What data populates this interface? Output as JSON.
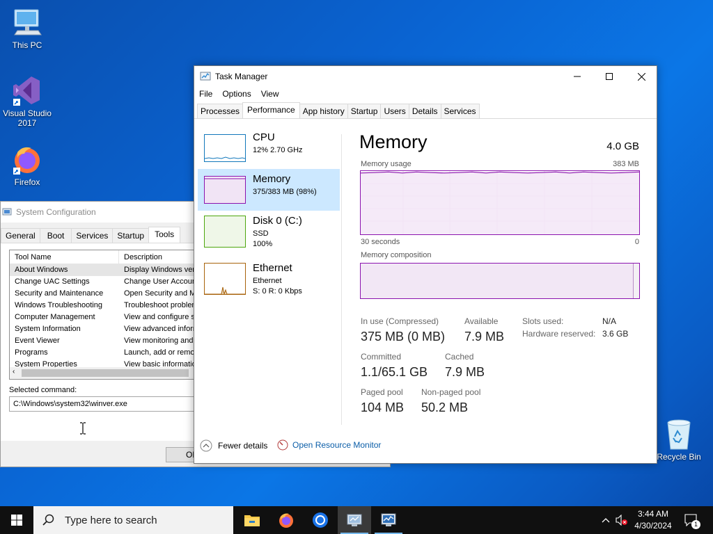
{
  "desktop": {
    "icons": [
      {
        "label": "This PC"
      },
      {
        "label": "Visual Studio 2017"
      },
      {
        "label": "Firefox"
      },
      {
        "label": "Recycle Bin"
      }
    ]
  },
  "msconfig": {
    "title": "System Configuration",
    "tabs": [
      "General",
      "Boot",
      "Services",
      "Startup",
      "Tools"
    ],
    "active_tab": "Tools",
    "columns": [
      "Tool Name",
      "Description"
    ],
    "rows": [
      {
        "name": "About Windows",
        "desc": "Display Windows version information."
      },
      {
        "name": "Change UAC Settings",
        "desc": "Change User Account Control settings."
      },
      {
        "name": "Security and Maintenance",
        "desc": "Open Security and Maintenance."
      },
      {
        "name": "Windows Troubleshooting",
        "desc": "Troubleshoot problems with your computer."
      },
      {
        "name": "Computer Management",
        "desc": "View and configure system settings and components."
      },
      {
        "name": "System Information",
        "desc": "View advanced information about hardware and software settings."
      },
      {
        "name": "Event Viewer",
        "desc": "View monitoring and troubleshooting messages."
      },
      {
        "name": "Programs",
        "desc": "Launch, add or remove programs and Windows components."
      },
      {
        "name": "System Properties",
        "desc": "View basic information about your computer system settings."
      }
    ],
    "selected_command_label": "Selected command:",
    "selected_command": "C:\\Windows\\system32\\winver.exe",
    "ok_label": "OK"
  },
  "taskmgr": {
    "title": "Task Manager",
    "menu": [
      "File",
      "Options",
      "View"
    ],
    "tabs": [
      "Processes",
      "Performance",
      "App history",
      "Startup",
      "Users",
      "Details",
      "Services"
    ],
    "active_tab": "Performance",
    "sidebar": [
      {
        "name": "CPU",
        "line1": "12%  2.70 GHz",
        "line2": "",
        "color": "#1177bb"
      },
      {
        "name": "Memory",
        "line1": "375/383 MB (98%)",
        "line2": "",
        "color": "#8b12ae"
      },
      {
        "name": "Disk 0 (C:)",
        "line1": "SSD",
        "line2": "100%",
        "color": "#4da60c"
      },
      {
        "name": "Ethernet",
        "line1": "Ethernet",
        "line2": "S: 0  R: 0 Kbps",
        "color": "#a7620a"
      }
    ],
    "memory": {
      "title": "Memory",
      "total": "4.0 GB",
      "usage_label": "Memory usage",
      "usage_max": "383 MB",
      "time_left": "30 seconds",
      "time_right": "0",
      "composition_label": "Memory composition",
      "stats": {
        "in_use_label": "In use (Compressed)",
        "in_use": "375 MB (0 MB)",
        "available_label": "Available",
        "available": "7.9 MB",
        "committed_label": "Committed",
        "committed": "1.1/65.1 GB",
        "cached_label": "Cached",
        "cached": "7.9 MB",
        "paged_label": "Paged pool",
        "paged": "104 MB",
        "nonpaged_label": "Non-paged pool",
        "nonpaged": "50.2 MB",
        "slots_label": "Slots used:",
        "slots": "N/A",
        "hw_label": "Hardware reserved:",
        "hw": "3.6 GB"
      },
      "usage_fraction": 0.98
    },
    "fewer_details": "Fewer details",
    "open_resource_monitor": "Open Resource Monitor"
  },
  "taskbar": {
    "search_placeholder": "Type here to search",
    "time": "3:44 AM",
    "date": "4/30/2024",
    "notification_count": "1"
  }
}
